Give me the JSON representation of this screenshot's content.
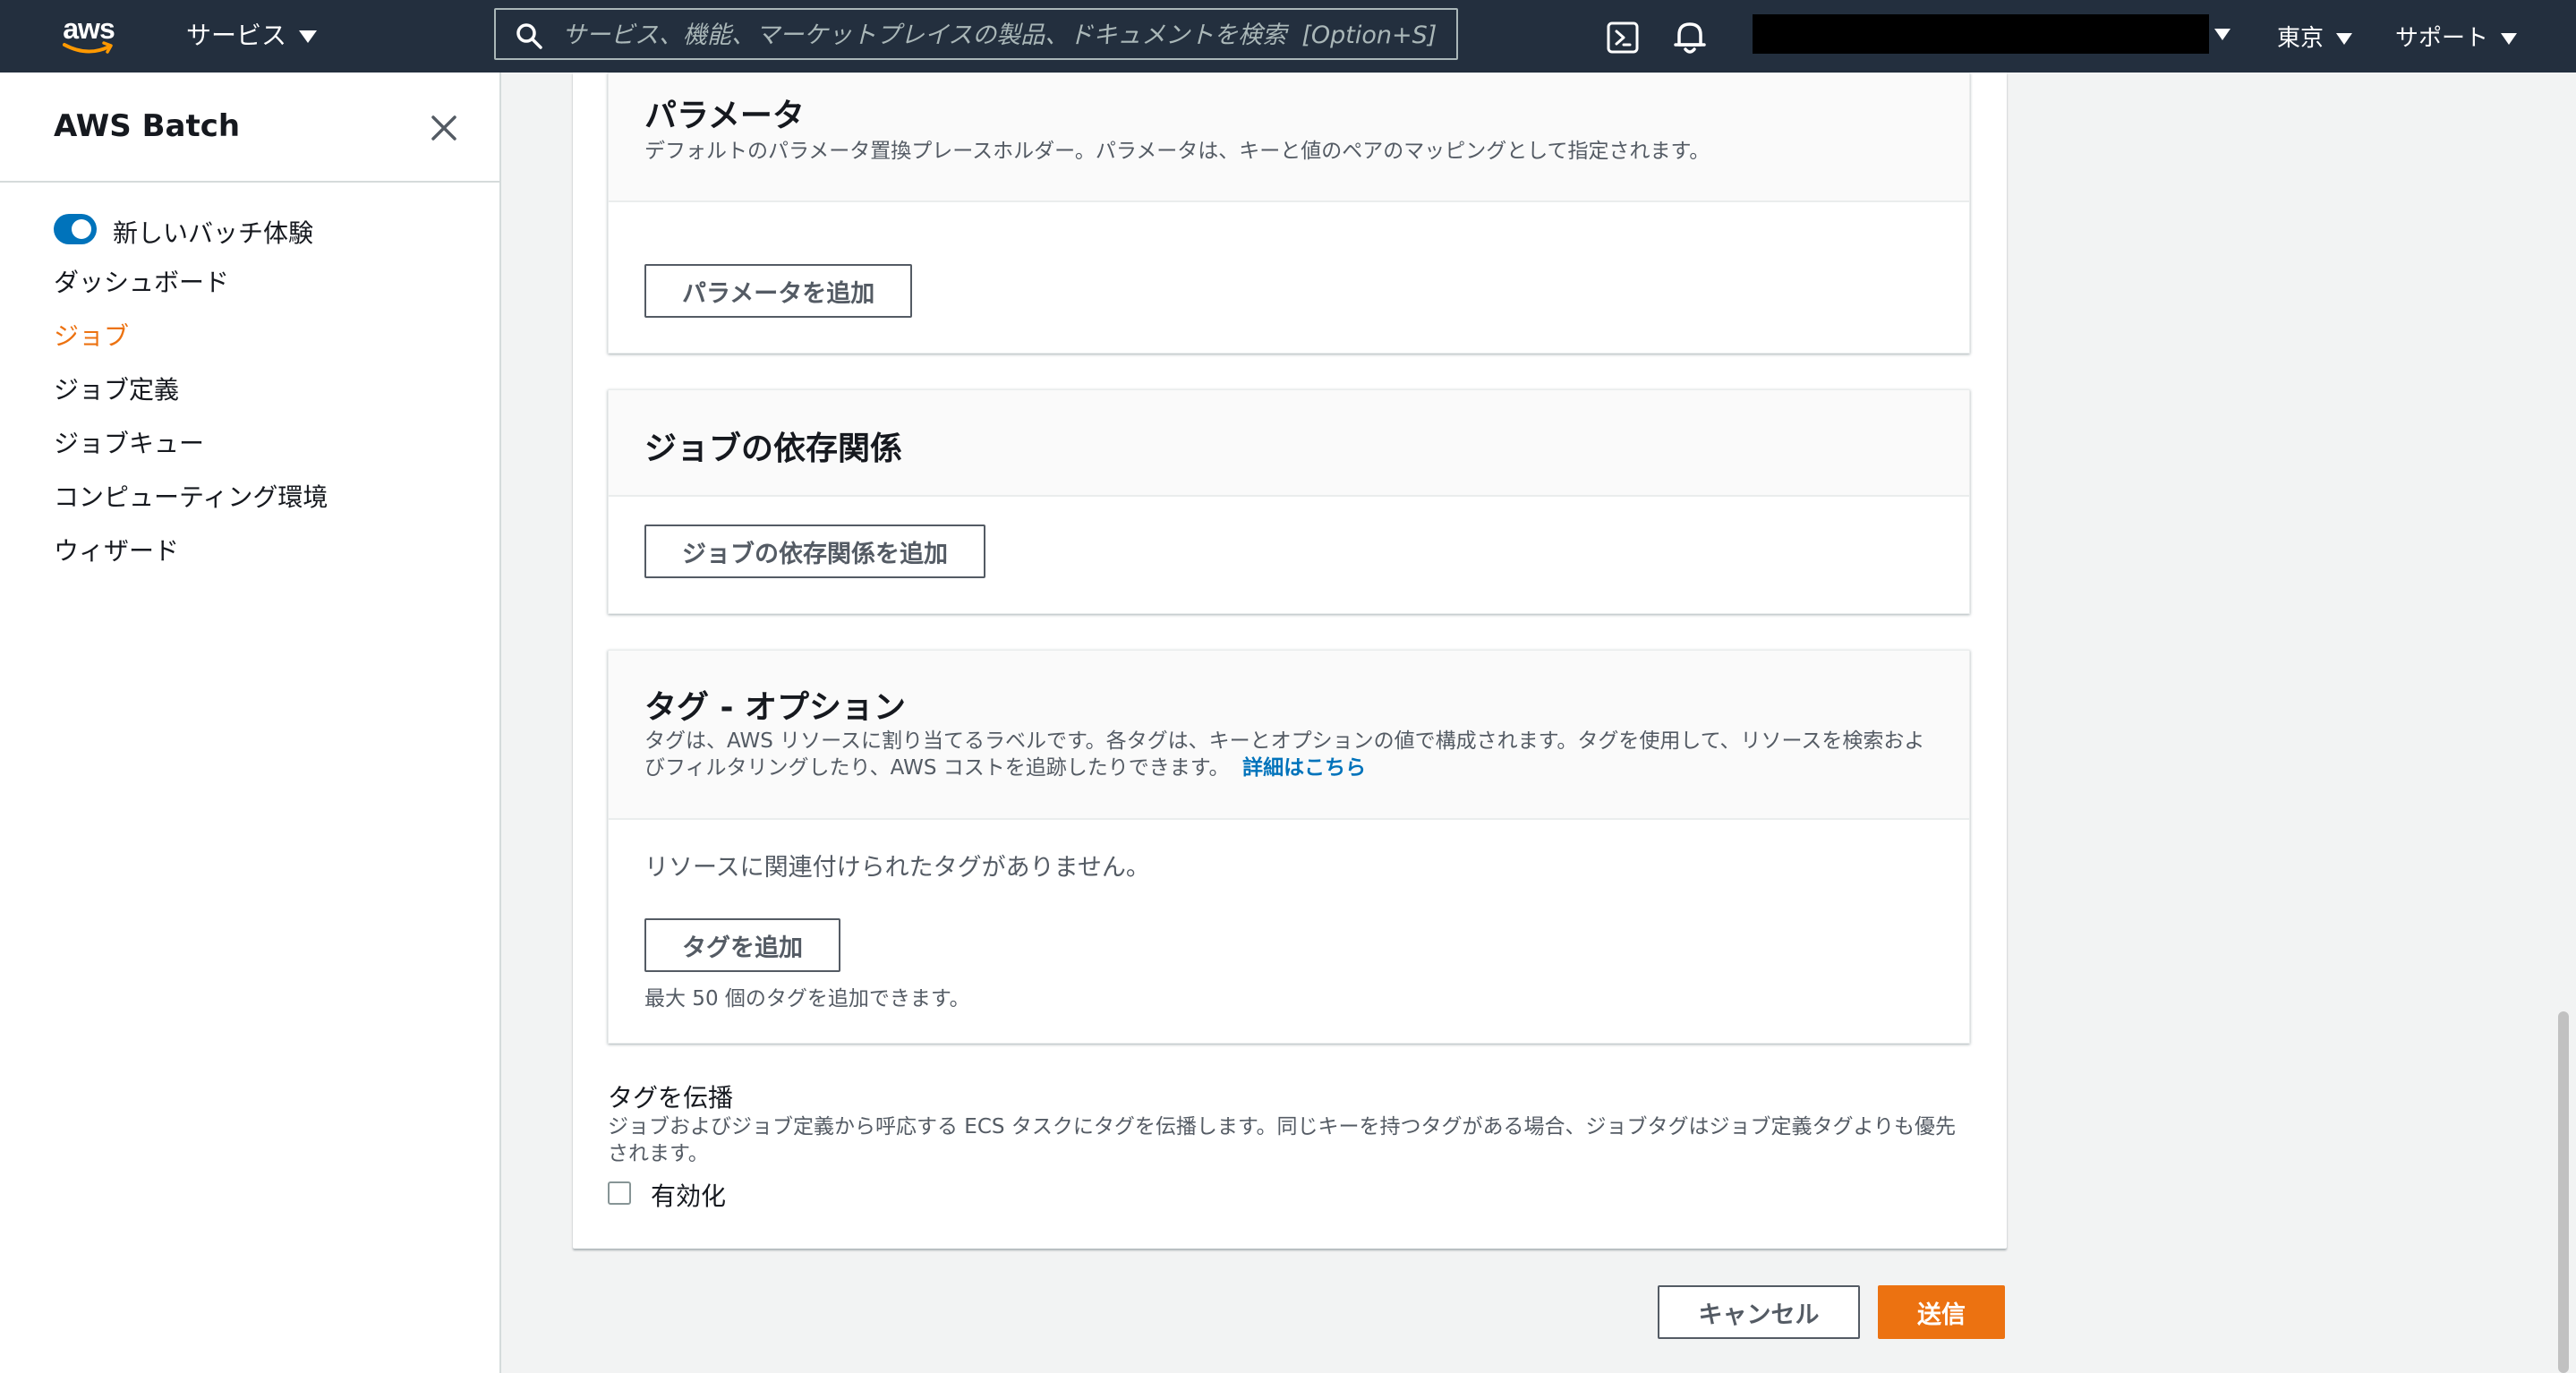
{
  "topnav": {
    "logo": "aws",
    "services_label": "サービス",
    "search_placeholder": "サービス、機能、マーケットプレイスの製品、ドキュメントを検索  [Option+S]",
    "region_label": "東京",
    "support_label": "サポート",
    "icons": [
      "search-icon",
      "cloudshell-icon",
      "bell-icon"
    ]
  },
  "sidebar": {
    "title": "AWS Batch",
    "toggle_label": "新しいバッチ体験",
    "toggle_on": true,
    "items": [
      {
        "label": "ダッシュボード",
        "active": false
      },
      {
        "label": "ジョブ",
        "active": true
      },
      {
        "label": "ジョブ定義",
        "active": false
      },
      {
        "label": "ジョブキュー",
        "active": false
      },
      {
        "label": "コンピューティング環境",
        "active": false
      },
      {
        "label": "ウィザード",
        "active": false
      }
    ]
  },
  "parameters": {
    "title": "パラメータ",
    "description": "デフォルトのパラメータ置換プレースホルダー。パラメータは、キーと値のペアのマッピングとして指定されます。",
    "add_button": "パラメータを追加"
  },
  "dependencies": {
    "title": "ジョブの依存関係",
    "add_button": "ジョブの依存関係を追加"
  },
  "tags": {
    "title": "タグ - オプション",
    "description": "タグは、AWS リソースに割り当てるラベルです。各タグは、キーとオプションの値で構成されます。タグを使用して、リソースを検索およびフィルタリングしたり、AWS コストを追跡したりできます。",
    "learn_more": "詳細はこちら",
    "empty_text": "リソースに関連付けられたタグがありません。",
    "add_button": "タグを追加",
    "hint": "最大 50 個のタグを追加できます。"
  },
  "propagate": {
    "title": "タグを伝播",
    "description": "ジョブおよびジョブ定義から呼応する ECS タスクにタグを伝播します。同じキーを持つタグがある場合、ジョブタグはジョブ定義タグよりも優先されます。",
    "checkbox_label": "有効化",
    "checked": false
  },
  "footer": {
    "cancel_label": "キャンセル",
    "submit_label": "送信"
  },
  "colors": {
    "nav_bg": "#232f3e",
    "accent_orange": "#ec7211",
    "link_blue": "#0073bb"
  }
}
